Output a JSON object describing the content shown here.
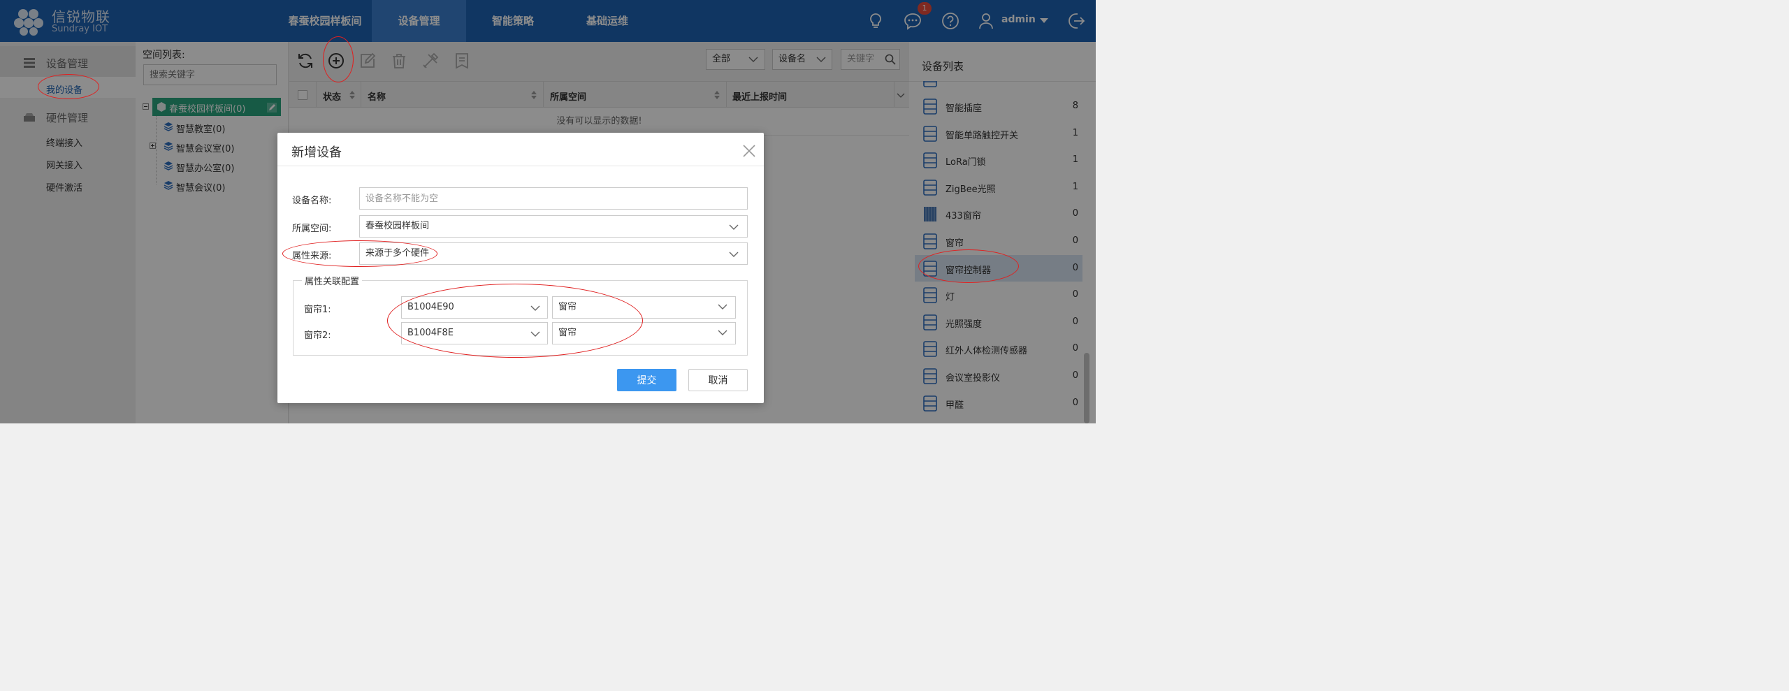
{
  "app": {
    "name": "信锐物联",
    "subtitle": "Sundray IOT"
  },
  "nav": {
    "tabs": [
      {
        "label": "春蚕校园样板间"
      },
      {
        "label": "设备管理"
      },
      {
        "label": "智能策略"
      },
      {
        "label": "基础运维"
      }
    ],
    "active_tab": "设备管理",
    "notification_count": "1",
    "user": "admin"
  },
  "sidebar": {
    "device_section": "设备管理",
    "device_items": [
      {
        "label": "我的设备"
      }
    ],
    "hardware_section": "硬件管理",
    "hardware_items": [
      {
        "label": "终端接入"
      },
      {
        "label": "网关接入"
      },
      {
        "label": "硬件激活"
      }
    ]
  },
  "space_tree": {
    "title": "空间列表:",
    "search_placeholder": "搜索关键字",
    "root": "春蚕校园样板间(0)",
    "children": [
      {
        "label": "智慧教室(0)"
      },
      {
        "label": "智慧会议室(0)"
      },
      {
        "label": "智慧办公室(0)"
      },
      {
        "label": "智慧会议(0)"
      }
    ]
  },
  "filters": {
    "scope": "全部",
    "field": "设备名",
    "keyword_placeholder": "关键字"
  },
  "grid": {
    "columns": [
      {
        "label": "状态"
      },
      {
        "label": "名称"
      },
      {
        "label": "所属空间"
      },
      {
        "label": "最近上报时间"
      }
    ],
    "empty_text": "没有可以显示的数据!"
  },
  "device_list": {
    "title": "设备列表",
    "items": [
      {
        "name": "智能插座",
        "count": "8"
      },
      {
        "name": "智能单路触控开关",
        "count": "1"
      },
      {
        "name": "LoRa门锁",
        "count": "1"
      },
      {
        "name": "ZigBee光照",
        "count": "1"
      },
      {
        "name": "433窗帘",
        "count": "0"
      },
      {
        "name": "窗帘",
        "count": "0"
      },
      {
        "name": "窗帘控制器",
        "count": "0"
      },
      {
        "name": "灯",
        "count": "0"
      },
      {
        "name": "光照强度",
        "count": "0"
      },
      {
        "name": "红外人体检测传感器",
        "count": "0"
      },
      {
        "name": "会议室投影仪",
        "count": "0"
      },
      {
        "name": "甲醛",
        "count": "0"
      }
    ]
  },
  "dialog": {
    "title": "新增设备",
    "name_label": "设备名称:",
    "name_placeholder": "设备名称不能为空",
    "space_label": "所属空间:",
    "space_value": "春蚕校园样板间",
    "source_label": "属性来源:",
    "source_value": "来源于多个硬件",
    "mapping_legend": "属性关联配置",
    "mappings": [
      {
        "label": "窗帘1:",
        "hardware": "B1004E90",
        "attribute": "窗帘"
      },
      {
        "label": "窗帘2:",
        "hardware": "B1004F8E",
        "attribute": "窗帘"
      }
    ],
    "submit": "提交",
    "cancel": "取消"
  },
  "colors": {
    "header": "#1e63b3",
    "header_active": "#3b7fce",
    "tree_selected": "#2aa47f",
    "primary_button": "#3c97f0",
    "annotation": "#e02020"
  }
}
